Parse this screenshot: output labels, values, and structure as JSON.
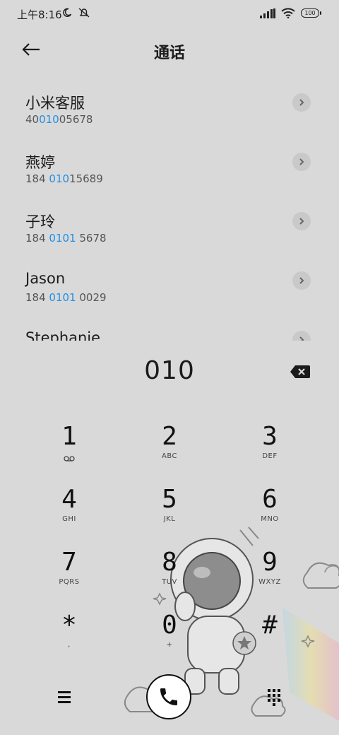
{
  "status": {
    "time": "上午8:16",
    "battery": "100"
  },
  "header": {
    "title": "通话"
  },
  "contacts": [
    {
      "name": "小米客服",
      "num_pre": "40",
      "num_hl": "010",
      "num_post": "05678"
    },
    {
      "name": "燕婷",
      "num_pre": "184 ",
      "num_hl": "010",
      "num_post": "15689"
    },
    {
      "name": "子玲",
      "num_pre": "184 ",
      "num_hl": "0101",
      "num_post": " 5678"
    },
    {
      "name": "Jason",
      "num_pre": "184 ",
      "num_hl": "0101",
      "num_post": " 0029"
    },
    {
      "name": "Stephanie",
      "num_pre": "",
      "num_hl": "",
      "num_post": ""
    }
  ],
  "dial": {
    "entry": "010"
  },
  "keys": [
    {
      "digit": "1",
      "letters": ""
    },
    {
      "digit": "2",
      "letters": "ABC"
    },
    {
      "digit": "3",
      "letters": "DEF"
    },
    {
      "digit": "4",
      "letters": "GHI"
    },
    {
      "digit": "5",
      "letters": "JKL"
    },
    {
      "digit": "6",
      "letters": "MNO"
    },
    {
      "digit": "7",
      "letters": "PQRS"
    },
    {
      "digit": "8",
      "letters": "TUV"
    },
    {
      "digit": "9",
      "letters": "WXYZ"
    },
    {
      "digit": "*",
      "letters": ","
    },
    {
      "digit": "0",
      "letters": "+"
    },
    {
      "digit": "#",
      "letters": ""
    }
  ],
  "colors": {
    "background": "#d9d9d9",
    "highlight": "#1f8fe6"
  }
}
